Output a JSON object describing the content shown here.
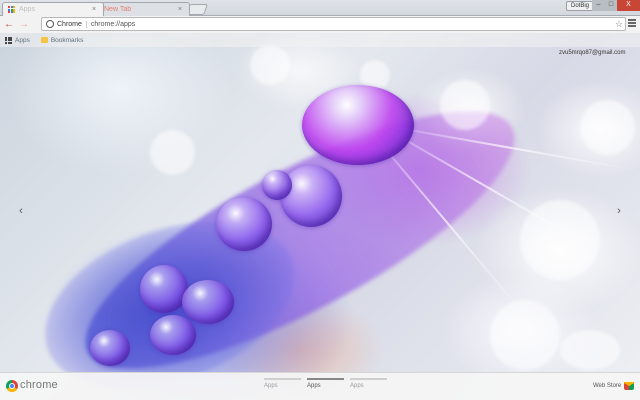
{
  "tabs": [
    {
      "title": "Apps",
      "active": true
    },
    {
      "title": "New Tab",
      "active": false
    }
  ],
  "window": {
    "profile_label": "DotBig",
    "min_glyph": "–",
    "max_glyph": "□",
    "close_glyph": "X"
  },
  "toolbar": {
    "back_glyph": "←",
    "forward_glyph": "→",
    "reload_glyph": "C",
    "omnibox_chip": "Chrome",
    "url": "chrome://apps",
    "star_glyph": "☆"
  },
  "bookmarks": [
    {
      "label": "Apps",
      "icon": "apps-grid-icon"
    },
    {
      "label": "Bookmarks",
      "icon": "folder-icon"
    }
  ],
  "page": {
    "user_email": "zvu5mrqo87@gmail.com",
    "prev_glyph": "‹",
    "next_glyph": "›"
  },
  "footer": {
    "brand": "chrome",
    "pages": [
      {
        "label": "Apps",
        "active": false
      },
      {
        "label": "Apps",
        "active": true
      },
      {
        "label": "Apps",
        "active": false
      }
    ],
    "webstore_label": "Web Store"
  },
  "colors": {
    "close_button": "#c94536",
    "back_arrow": "#c0392b",
    "wallpaper_primary": "#7c5ce8"
  }
}
